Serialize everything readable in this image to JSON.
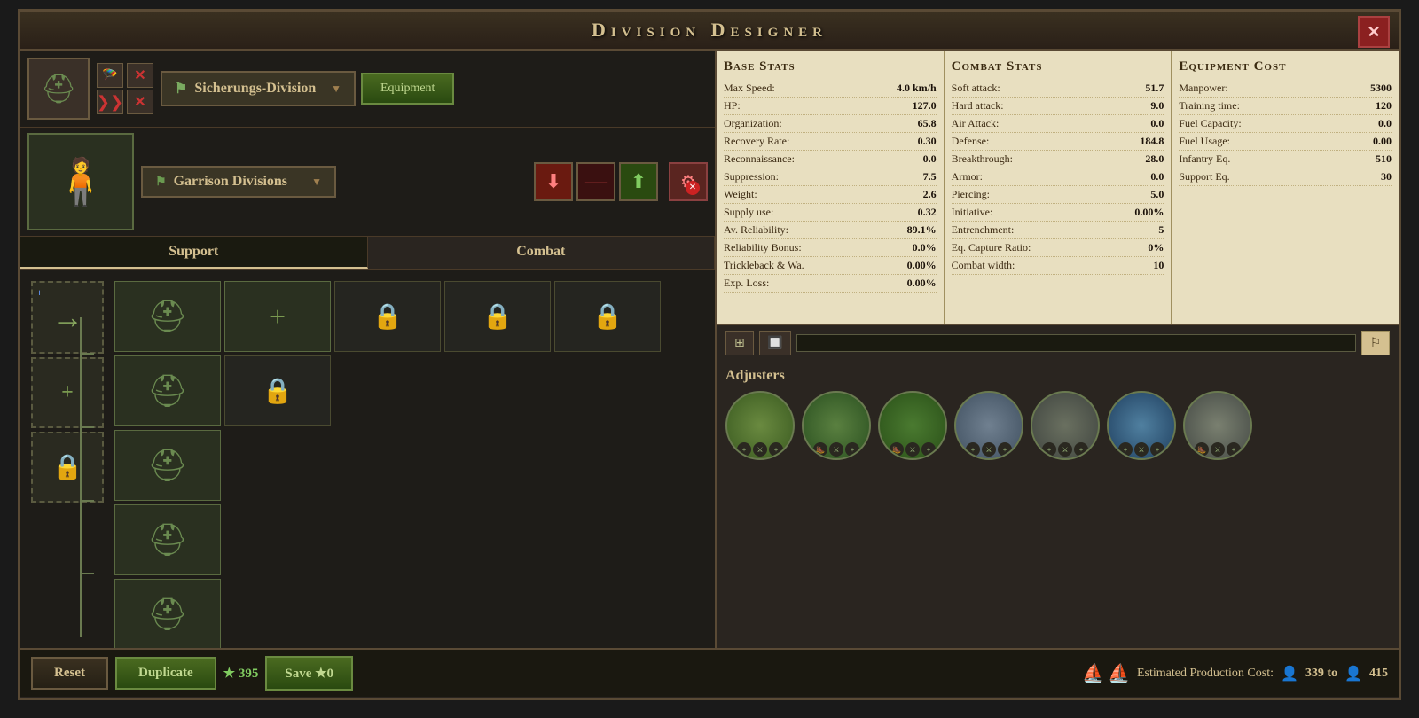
{
  "window": {
    "title": "Division Designer",
    "close_label": "✕"
  },
  "left": {
    "division_name": "Sicherungs-Division",
    "dropdown_arrow": "▼",
    "equipment_btn": "Equipment",
    "garrison_label": "Garrison Divisions",
    "support_tab": "Support",
    "combat_tab": "Combat"
  },
  "right": {
    "base_stats_header": "Base Stats",
    "combat_stats_header": "Combat Stats",
    "equipment_cost_header": "Equipment Cost",
    "stats": {
      "base": [
        {
          "label": "Max Speed:",
          "value": "4.0 km/h"
        },
        {
          "label": "HP:",
          "value": "127.0"
        },
        {
          "label": "Organization:",
          "value": "65.8"
        },
        {
          "label": "Recovery Rate:",
          "value": "0.30"
        },
        {
          "label": "Reconnaissance:",
          "value": "0.0"
        },
        {
          "label": "Suppression:",
          "value": "7.5"
        },
        {
          "label": "Weight:",
          "value": "2.6"
        },
        {
          "label": "Supply use:",
          "value": "0.32"
        },
        {
          "label": "Av. Reliability:",
          "value": "89.1%"
        },
        {
          "label": "Reliability Bonus:",
          "value": "0.0%"
        },
        {
          "label": "Trickleback & Wa.:",
          "value": "0.00%"
        },
        {
          "label": "Exp. Loss:",
          "value": "0.00%"
        }
      ],
      "combat": [
        {
          "label": "Soft attack:",
          "value": "51.7"
        },
        {
          "label": "Hard attack:",
          "value": "9.0"
        },
        {
          "label": "Air Attack:",
          "value": "0.0"
        },
        {
          "label": "Defense:",
          "value": "184.8"
        },
        {
          "label": "Breakthrough:",
          "value": "28.0"
        },
        {
          "label": "Armor:",
          "value": "0.0"
        },
        {
          "label": "Piercing:",
          "value": "5.0"
        },
        {
          "label": "Initiative:",
          "value": "0.00%"
        },
        {
          "label": "Entrenchment:",
          "value": "5"
        },
        {
          "label": "Eq. Capture Ratio:",
          "value": "0%"
        },
        {
          "label": "Combat width:",
          "value": "10"
        }
      ],
      "equipment": [
        {
          "label": "Manpower:",
          "value": "5300"
        },
        {
          "label": "Training time:",
          "value": "120"
        },
        {
          "label": "Fuel Capacity:",
          "value": "0.0"
        },
        {
          "label": "Fuel Usage:",
          "value": "0.00"
        },
        {
          "label": "Infantry Eq.",
          "value": "510"
        },
        {
          "label": "Support Eq.",
          "value": "30"
        }
      ]
    },
    "adjusters_title": "Adjusters"
  },
  "bottom": {
    "reset_label": "Reset",
    "duplicate_label": "Duplicate",
    "xp_value": "★ 395",
    "save_label": "Save ★0",
    "production_label": "Estimated Production Cost:",
    "production_range": "339 to",
    "production_max": "415"
  }
}
